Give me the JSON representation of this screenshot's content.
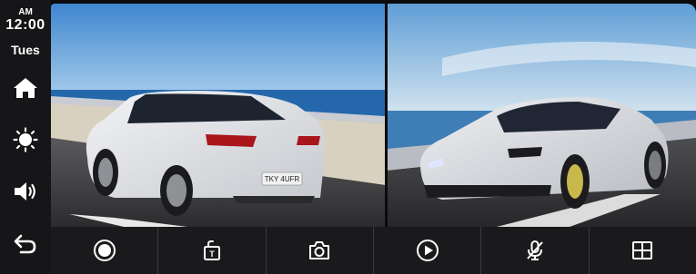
{
  "status": {
    "ampm": "AM",
    "time": "12:00",
    "day": "Tues"
  },
  "sidebar": {
    "items": [
      {
        "icon": "home-icon"
      },
      {
        "icon": "brightness-icon"
      },
      {
        "icon": "volume-icon"
      },
      {
        "icon": "back-arrow-icon"
      }
    ]
  },
  "cameras": {
    "front_plate": "TKY 4UFR"
  },
  "toolbar": {
    "items": [
      {
        "icon": "record-icon"
      },
      {
        "icon": "lock-file-icon"
      },
      {
        "icon": "camera-icon"
      },
      {
        "icon": "play-icon"
      },
      {
        "icon": "mic-muted-icon"
      },
      {
        "icon": "split-view-icon"
      }
    ]
  },
  "colors": {
    "sidebar_bg": "#161618",
    "toolbar_bg": "#1a1a1c",
    "icon": "#ffffff"
  }
}
